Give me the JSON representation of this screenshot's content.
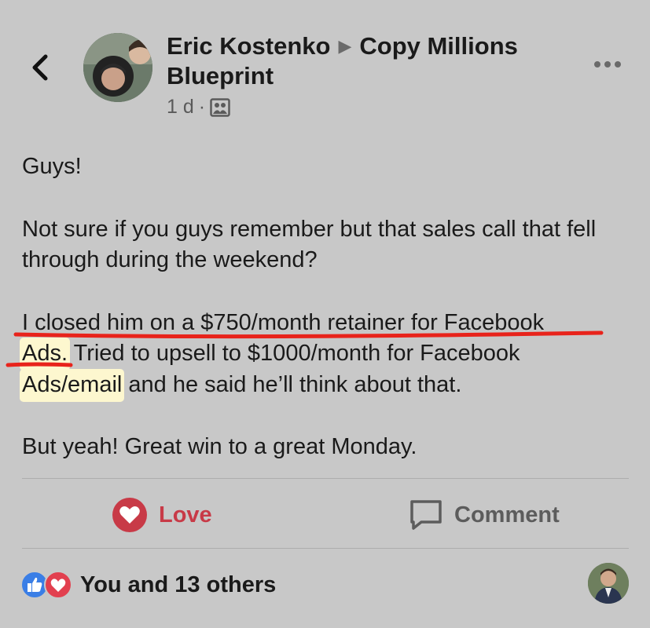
{
  "header": {
    "author": "Eric Kostenko",
    "group": "Copy Millions Blueprint",
    "time": "1 d",
    "separator": "·",
    "audience_icon": "group-photo-icon",
    "back_icon": "chevron-left-icon",
    "more_icon": "more-dots-icon"
  },
  "post": {
    "line_greeting": "Guys!",
    "para2": "Not sure if you guys remember but that sales call that fell through during the weekend?",
    "para3_part1": "I closed him on a $750/month retainer for Facebook",
    "para3_hl1": "Ads.",
    "para3_mid": " Tried to upsell to $1000/month for Facebook ",
    "para3_hl2": "Ads/email",
    "para3_end": " and he said he’ll think about that.",
    "para4": "But yeah! Great win to a great Monday.",
    "highlight_color": "#fdf7cf",
    "underline_color": "#e8231b"
  },
  "actions": {
    "love_label": "Love",
    "comment_label": "Comment",
    "love_color": "#c83a47"
  },
  "reactions": {
    "summary": "You and 13 others",
    "icons": [
      "like-icon",
      "heart-icon"
    ]
  }
}
